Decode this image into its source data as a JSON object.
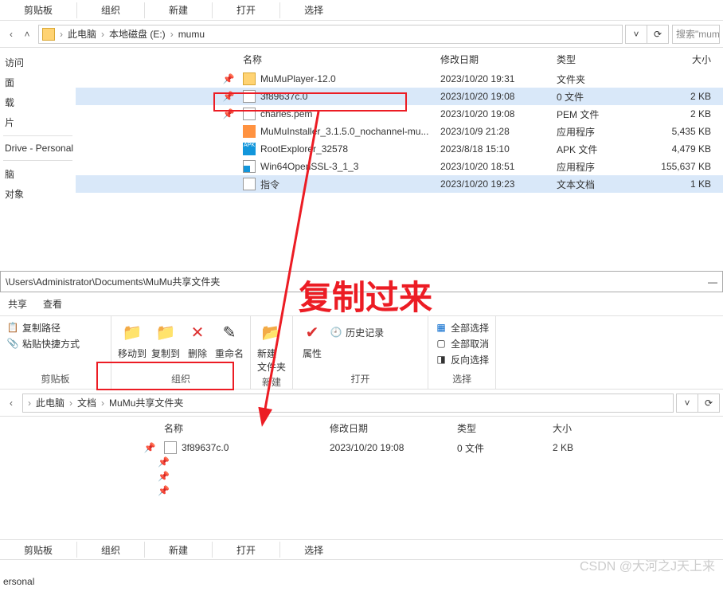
{
  "win1": {
    "ribbon_groups": [
      "剪贴板",
      "组织",
      "新建",
      "打开",
      "选择"
    ],
    "breadcrumbs": [
      "此电脑",
      "本地磁盘 (E:)",
      "mumu"
    ],
    "search_placeholder": "搜索\"mum",
    "sidebar": [
      "访问",
      "面",
      "载",
      "片",
      "Drive - Personal",
      "脑",
      "对象"
    ],
    "columns": {
      "name": "名称",
      "date": "修改日期",
      "type": "类型",
      "size": "大小"
    },
    "files": [
      {
        "icon": "folder",
        "name": "MuMuPlayer-12.0",
        "date": "2023/10/20 19:31",
        "type": "文件夹",
        "size": "",
        "pin": true
      },
      {
        "icon": "file",
        "name": "3f89637c.0",
        "date": "2023/10/20 19:08",
        "type": "0 文件",
        "size": "2 KB",
        "pin": true,
        "sel": true
      },
      {
        "icon": "file",
        "name": "charles.pem",
        "date": "2023/10/20 19:08",
        "type": "PEM 文件",
        "size": "2 KB",
        "pin": true
      },
      {
        "icon": "cube",
        "name": "MuMuInstaller_3.1.5.0_nochannel-mu...",
        "date": "2023/10/9 21:28",
        "type": "应用程序",
        "size": "5,435 KB"
      },
      {
        "icon": "apk",
        "name": "RootExplorer_32578",
        "date": "2023/8/18 15:10",
        "type": "APK 文件",
        "size": "4,479 KB"
      },
      {
        "icon": "exe",
        "name": "Win64OpenSSL-3_1_3",
        "date": "2023/10/20 18:51",
        "type": "应用程序",
        "size": "155,637 KB"
      },
      {
        "icon": "txt",
        "name": "指令",
        "date": "2023/10/20 19:23",
        "type": "文本文档",
        "size": "1 KB",
        "sel": true
      }
    ]
  },
  "win2": {
    "title_path": "\\Users\\Administrator\\Documents\\MuMu共享文件夹",
    "tabs": [
      "共享",
      "查看"
    ],
    "ribbon": {
      "clip": {
        "label": "剪贴板",
        "copy_path": "复制路径",
        "paste_shortcut": "粘贴快捷方式"
      },
      "org": {
        "label": "组织",
        "move": "移动到",
        "copy": "复制到",
        "delete": "删除",
        "rename": "重命名"
      },
      "new": {
        "label": "新建",
        "folder": "新建\n文件夹"
      },
      "open": {
        "label": "打开",
        "props": "属性",
        "history": "历史记录"
      },
      "sel": {
        "label": "选择",
        "all": "全部选择",
        "none": "全部取消",
        "inv": "反向选择"
      }
    },
    "breadcrumbs": [
      "此电脑",
      "文档",
      "MuMu共享文件夹"
    ],
    "columns": {
      "name": "名称",
      "date": "修改日期",
      "type": "类型",
      "size": "大小"
    },
    "files": [
      {
        "icon": "file",
        "name": "3f89637c.0",
        "date": "2023/10/20 19:08",
        "type": "0 文件",
        "size": "2 KB",
        "pin": true
      }
    ],
    "sidebar_bottom": "ersonal"
  },
  "annotation": "复制过来",
  "watermark": "CSDN @大河之J天上来"
}
